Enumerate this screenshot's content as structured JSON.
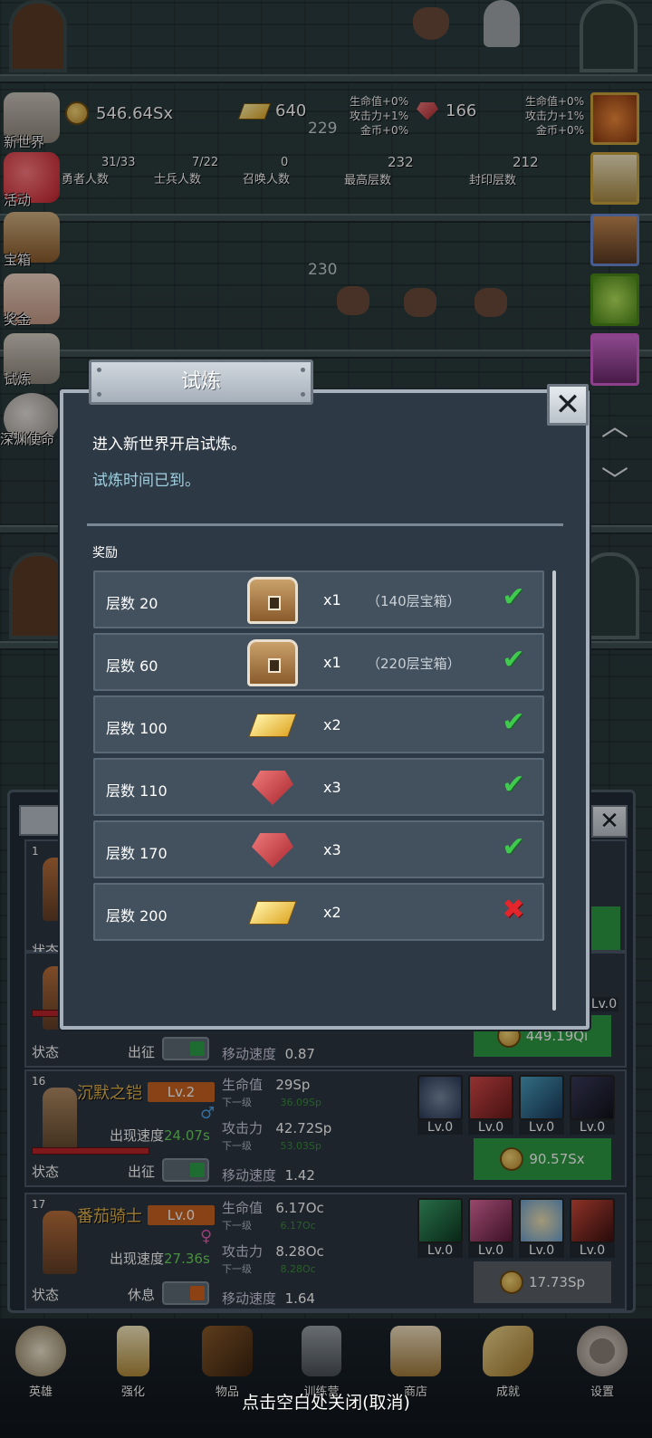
{
  "top_bar": {
    "currency_coins": "546.64Sx",
    "currency_goldbars": "640",
    "currency_gems": "166",
    "bonus_left": [
      "生命值+0%",
      "攻击力+1%",
      "金币+0%"
    ],
    "bonus_right": [
      "生命值+0%",
      "攻击力+1%",
      "金币+0%"
    ]
  },
  "floor_numbers": [
    "229",
    "230"
  ],
  "stats": [
    {
      "value": "31/33",
      "label": "勇者人数"
    },
    {
      "value": "7/22",
      "label": "士兵人数"
    },
    {
      "value": "0",
      "label": "召唤人数"
    },
    {
      "value": "232",
      "label": "最高层数"
    },
    {
      "value": "212",
      "label": "封印层数"
    }
  ],
  "left_menu": [
    "新世界",
    "活动",
    "宝箱",
    "奖金",
    "试炼",
    "深渊使命"
  ],
  "dialog": {
    "title": "试炼",
    "line1": "进入新世界开启试炼。",
    "line2": "试炼时间已到。",
    "rewards_label": "奖励",
    "rewards": [
      {
        "floor": "层数 20",
        "icon": "chest-icon",
        "qty": "x1",
        "note": "（140层宝箱）",
        "status": "claimed"
      },
      {
        "floor": "层数 60",
        "icon": "chest-icon",
        "qty": "x1",
        "note": "（220层宝箱）",
        "status": "claimed"
      },
      {
        "floor": "层数 100",
        "icon": "gold-bar-icon",
        "qty": "x2",
        "note": "",
        "status": "claimed"
      },
      {
        "floor": "层数 110",
        "icon": "red-gem-icon",
        "qty": "x3",
        "note": "",
        "status": "claimed"
      },
      {
        "floor": "层数 170",
        "icon": "red-gem-icon",
        "qty": "x3",
        "note": "",
        "status": "claimed"
      },
      {
        "floor": "层数 200",
        "icon": "gold-bar-icon",
        "qty": "x2",
        "note": "",
        "status": "not-claimed"
      }
    ]
  },
  "heroes_partial": {
    "first_num": "1",
    "state_label": "状态",
    "deploy_label": "出征",
    "move_label": "移动速度",
    "move_value": "0.87",
    "buy_price": "449.19Qi",
    "skill_lv": "Lv.0"
  },
  "heroes": [
    {
      "num": "16",
      "name": "沉默之铠",
      "lv": "Lv.2",
      "gender": "♂",
      "gender_color": "#4aa3e8",
      "speed_label": "出现速度",
      "speed": "24.07s",
      "hp_label": "生命值",
      "hp": "29Sp",
      "hp_next_label": "下一级",
      "hp_next": "36.09Sp",
      "atk_label": "攻击力",
      "atk": "42.72Sp",
      "atk_next_label": "下一级",
      "atk_next": "53.03Sp",
      "move_label": "移动速度",
      "move": "1.42",
      "state_label": "状态",
      "deploy_label": "出征",
      "deploy_on": true,
      "skills": [
        "Lv.0",
        "Lv.0",
        "Lv.0",
        "Lv.0"
      ],
      "price": "90.57Sx",
      "buy_color": "#2f9a43"
    },
    {
      "num": "17",
      "name": "番茄骑士",
      "lv": "Lv.0",
      "gender": "♀",
      "gender_color": "#e85ab0",
      "speed_label": "出现速度",
      "speed": "27.36s",
      "hp_label": "生命值",
      "hp": "6.17Oc",
      "hp_next_label": "下一级",
      "hp_next": "6.17Oc",
      "atk_label": "攻击力",
      "atk": "8.28Oc",
      "atk_next_label": "下一级",
      "atk_next": "8.28Oc",
      "move_label": "移动速度",
      "move": "1.64",
      "state_label": "状态",
      "deploy_label": "休息",
      "deploy_on": false,
      "skills": [
        "Lv.0",
        "Lv.0",
        "Lv.0",
        "Lv.0"
      ],
      "price": "17.73Sp",
      "buy_color": "#5b6168"
    }
  ],
  "dock": [
    "英雄",
    "强化",
    "物品",
    "训练营",
    "商店",
    "成就",
    "设置"
  ],
  "hint": "点击空白处关闭(取消)",
  "colors": {
    "check": "#3fca4e",
    "cross": "#e2262c",
    "dialog_bg": "#2e3946",
    "accent_gold": "#e9b84b"
  }
}
